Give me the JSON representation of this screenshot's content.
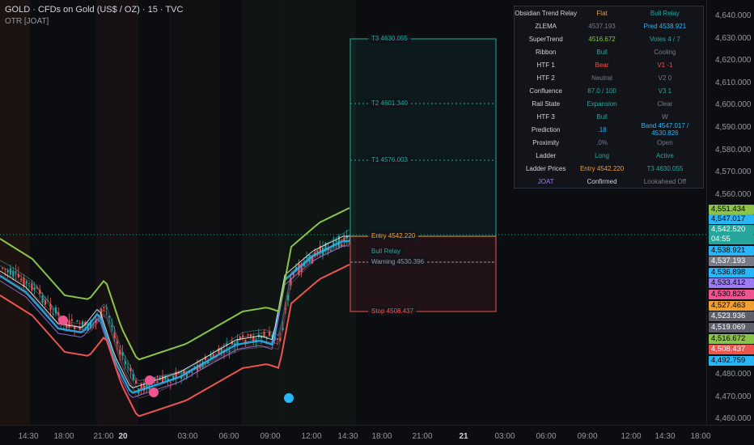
{
  "header": {
    "title": "GOLD · CFDs on Gold (US$ / OZ) · 15 · TVC",
    "indicator": "OTR [JOAT]"
  },
  "info_table": [
    {
      "label": "Obsidian Trend Relay",
      "v1": "Flat",
      "v1_color": "#f0a030",
      "v2": "Bull Relay",
      "v2_color": "#26a69a"
    },
    {
      "label": "ZLEMA",
      "v1": "4537.193",
      "v1_color": "#787b86",
      "v2": "Pred 4538.921",
      "v2_color": "#29b6f6"
    },
    {
      "label": "SuperTrend",
      "v1": "4516.672",
      "v1_color": "#8bc34a",
      "v2": "Votes 4 / 7",
      "v2_color": "#26a69a"
    },
    {
      "label": "Ribbon",
      "v1": "Bull",
      "v1_color": "#26a69a",
      "v2": "Cooling",
      "v2_color": "#787b86"
    },
    {
      "label": "HTF 1",
      "v1": "Bear",
      "v1_color": "#ef5350",
      "v2": "V1 -1",
      "v2_color": "#ef5350"
    },
    {
      "label": "HTF 2",
      "v1": "Neutral",
      "v1_color": "#787b86",
      "v2": "V2 0",
      "v2_color": "#787b86"
    },
    {
      "label": "Confluence",
      "v1": "87.0 / 100",
      "v1_color": "#26a69a",
      "v2": "V3 1",
      "v2_color": "#26a69a"
    },
    {
      "label": "Rail State",
      "v1": "Expansion",
      "v1_color": "#26a69a",
      "v2": "Clear",
      "v2_color": "#787b86"
    },
    {
      "label": "HTF 3",
      "v1": "Bull",
      "v1_color": "#26a69a",
      "v2": "W",
      "v2_color": "#787b86"
    },
    {
      "label": "Prediction",
      "v1": ".18",
      "v1_color": "#29b6f6",
      "v2": "Band 4547.017 / 4530.826",
      "v2_color": "#29b6f6"
    },
    {
      "label": "Proximity",
      "v1": ".0%",
      "v1_color": "#787b86",
      "v2": "Open",
      "v2_color": "#787b86"
    },
    {
      "label": "Ladder",
      "v1": "Long",
      "v1_color": "#26a69a",
      "v2": "Active",
      "v2_color": "#26a69a"
    },
    {
      "label": "Ladder Prices",
      "v1": "Entry 4542.220",
      "v1_color": "#f0a030",
      "v2": "T3 4630.055",
      "v2_color": "#26a69a"
    },
    {
      "label": "JOAT",
      "label_color": "#9c7cf0",
      "v1": "Confirmed",
      "v1_color": "#d1d4dc",
      "v2": "Lookahead Off",
      "v2_color": "#787b86"
    }
  ],
  "levels": [
    {
      "name": "t3",
      "text": "T3  4630.055",
      "color": "#26a69a"
    },
    {
      "name": "t2",
      "text": "T2  4601.340",
      "color": "#26a69a"
    },
    {
      "name": "t1",
      "text": "T1  4576.003",
      "color": "#26a69a"
    },
    {
      "name": "entry",
      "text": "Entry  4542.220",
      "color": "#f0a030"
    },
    {
      "name": "relay",
      "text": "Bull Relay",
      "color": "#26a69a"
    },
    {
      "name": "warning",
      "text": "Warning  4530.396",
      "color": "#9598a1"
    },
    {
      "name": "stop",
      "text": "Stop  4508.437",
      "color": "#ef5350"
    }
  ],
  "price_ticks": [
    "4,640.000",
    "4,630.000",
    "4,620.000",
    "4,610.000",
    "4,600.000",
    "4,590.000",
    "4,580.000",
    "4,570.000",
    "4,560.000",
    "4,480.000",
    "4,470.000",
    "4,460.000"
  ],
  "price_badges": [
    {
      "text": "4,551.434",
      "bg": "#8bc34a",
      "fg": "#000000"
    },
    {
      "text": "4,547.017",
      "bg": "#29b6f6",
      "fg": "#000000"
    },
    {
      "text": "4,542.520",
      "bg": "#26a69a",
      "fg": "#ffffff"
    },
    {
      "text": "04:55",
      "bg": "#26a69a",
      "fg": "#ffffff"
    },
    {
      "text": "4,538.921",
      "bg": "#29b6f6",
      "fg": "#000000"
    },
    {
      "text": "4,537.193",
      "bg": "#787b86",
      "fg": "#ffffff"
    },
    {
      "text": "4,536.898",
      "bg": "#29b6f6",
      "fg": "#000000"
    },
    {
      "text": "4,533.412",
      "bg": "#9c7cf0",
      "fg": "#000000"
    },
    {
      "text": "4,530.826",
      "bg": "#ef5390",
      "fg": "#000000"
    },
    {
      "text": "4,527.463",
      "bg": "#f0a030",
      "fg": "#000000"
    },
    {
      "text": "4,523.936",
      "bg": "#5d606b",
      "fg": "#ffffff"
    },
    {
      "text": "4,519.069",
      "bg": "#5d606b",
      "fg": "#ffffff"
    },
    {
      "text": "4,516.672",
      "bg": "#8bc34a",
      "fg": "#000000"
    },
    {
      "text": "4,508.437",
      "bg": "#ef5350",
      "fg": "#ffffff"
    },
    {
      "text": "4,492.759",
      "bg": "#29b6f6",
      "fg": "#000000"
    }
  ],
  "time_ticks": [
    {
      "text": "14:30",
      "bold": false
    },
    {
      "text": "18:00",
      "bold": false
    },
    {
      "text": "21:00",
      "bold": false
    },
    {
      "text": "20",
      "bold": true
    },
    {
      "text": "03:00",
      "bold": false
    },
    {
      "text": "06:00",
      "bold": false
    },
    {
      "text": "09:00",
      "bold": false
    },
    {
      "text": "12:00",
      "bold": false
    },
    {
      "text": "14:30",
      "bold": false
    },
    {
      "text": "18:00",
      "bold": false
    },
    {
      "text": "21:00",
      "bold": false
    },
    {
      "text": "21",
      "bold": true
    },
    {
      "text": "03:00",
      "bold": false
    },
    {
      "text": "06:00",
      "bold": false
    },
    {
      "text": "09:00",
      "bold": false
    },
    {
      "text": "12:00",
      "bold": false
    },
    {
      "text": "14:30",
      "bold": false
    },
    {
      "text": "18:00",
      "bold": false
    }
  ],
  "colors": {
    "bull": "#26a69a",
    "bear": "#ef5350",
    "lime": "#8bc34a",
    "cyan": "#29b6f6",
    "orange": "#f0a030"
  }
}
